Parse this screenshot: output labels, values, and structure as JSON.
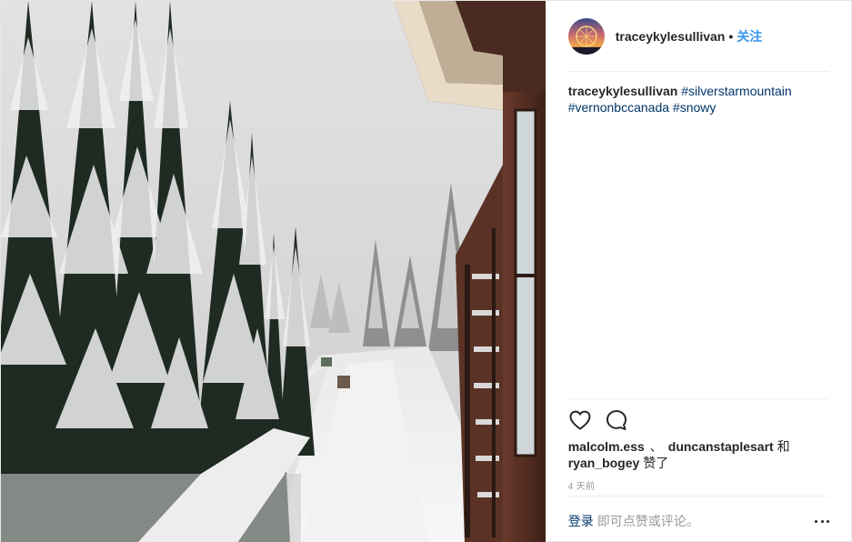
{
  "post": {
    "username": "traceykylesullivan",
    "separator": "•",
    "follow_label": "关注"
  },
  "caption": {
    "username": "traceykylesullivan",
    "hashtags": [
      "#silverstarmountain",
      "#vernonbccanada",
      "#snowy"
    ]
  },
  "likes": {
    "likers": [
      "malcolm.ess",
      "duncanstaplesart",
      "ryan_bogey"
    ],
    "separator": "、",
    "and_word": "和",
    "suffix": "赞了"
  },
  "timestamp": "4 天前",
  "footer": {
    "login_label": "登录",
    "login_hint": "即可点赞或评论。"
  },
  "icons": {
    "like": "heart-icon",
    "comment": "comment-bubble-icon",
    "more": "more-options-icon"
  },
  "colors": {
    "link_blue": "#003569",
    "follow_blue": "#3897f0",
    "muted": "#999999"
  }
}
